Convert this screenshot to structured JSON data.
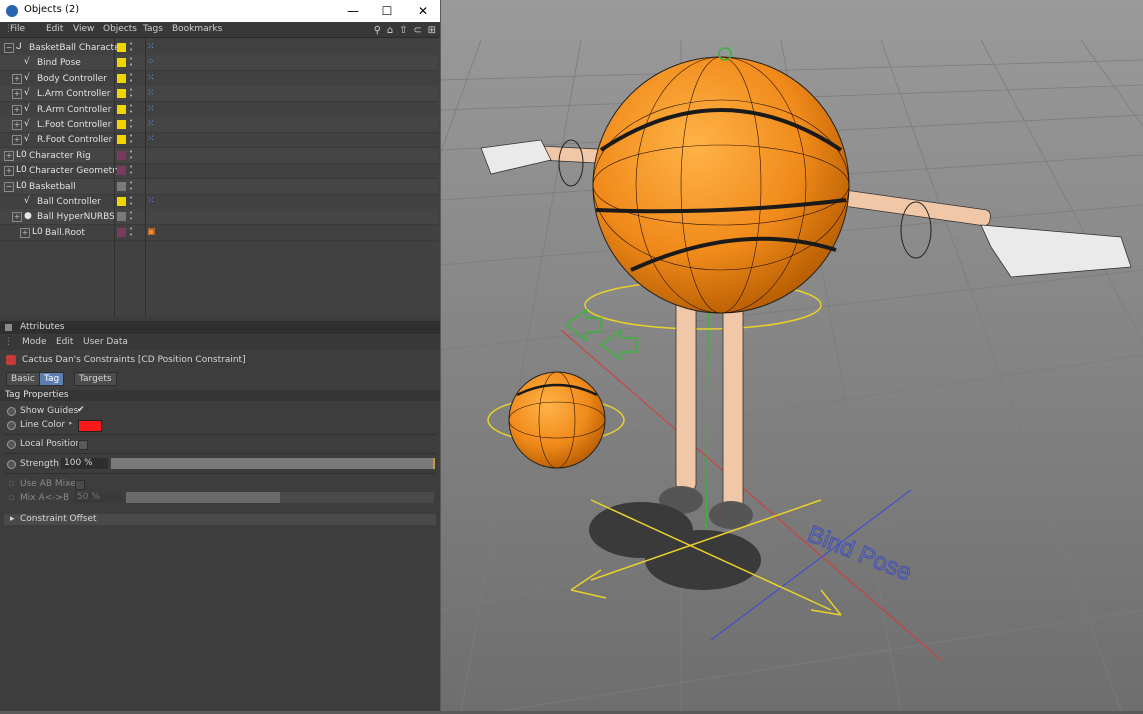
{
  "window": {
    "title": "Objects (2)",
    "minimize": "—",
    "maximize": "☐",
    "close": "✕"
  },
  "objects_menu": [
    "File",
    "Edit",
    "View",
    "Objects",
    "Tags",
    "Bookmarks"
  ],
  "tree": [
    {
      "label": "BasketBall Character",
      "indent": 0,
      "icon": "null-icon",
      "expand": "−",
      "color": "#f2d400",
      "tag": "xpresso-tag"
    },
    {
      "label": "Bind Pose",
      "indent": 1,
      "icon": "spline-icon",
      "expand": "",
      "color": "#f2d400",
      "tag": "pose-tag"
    },
    {
      "label": "Body Controller",
      "indent": 1,
      "icon": "spline-icon",
      "expand": "+",
      "color": "#f2d400",
      "tag": "xpresso-tag"
    },
    {
      "label": "L.Arm Controller",
      "indent": 1,
      "icon": "spline-icon",
      "expand": "+",
      "color": "#f2d400",
      "tag": "xpresso-tag"
    },
    {
      "label": "R.Arm Controller",
      "indent": 1,
      "icon": "spline-icon",
      "expand": "+",
      "color": "#f2d400",
      "tag": "xpresso-tag"
    },
    {
      "label": "L.Foot Controller",
      "indent": 1,
      "icon": "spline-icon",
      "expand": "+",
      "color": "#f2d400",
      "tag": "xpresso-tag"
    },
    {
      "label": "R.Foot Controller",
      "indent": 1,
      "icon": "spline-icon",
      "expand": "+",
      "color": "#f2d400",
      "tag": "xpresso-tag"
    },
    {
      "label": "Character Rig",
      "indent": 0,
      "icon": "null-object-icon",
      "expand": "+",
      "color": "#7a3a5e",
      "tag": ""
    },
    {
      "label": "Character Geometry",
      "indent": 0,
      "icon": "null-object-icon",
      "expand": "+",
      "color": "#7a3a5e",
      "tag": ""
    },
    {
      "label": "Basketball",
      "indent": 0,
      "icon": "null-object-icon",
      "expand": "−",
      "color": "#7a7a7a",
      "tag": ""
    },
    {
      "label": "Ball Controller",
      "indent": 1,
      "icon": "spline-icon",
      "expand": "",
      "color": "#f2d400",
      "tag": "xpresso-tag"
    },
    {
      "label": "Ball HyperNURBS",
      "indent": 1,
      "icon": "hypernurbs-icon",
      "expand": "+",
      "color": "#7a7a7a",
      "tag": ""
    },
    {
      "label": "Ball.Root",
      "indent": 2,
      "icon": "null-object-icon",
      "expand": "+",
      "color": "#7a3a5e",
      "tag": "constraint-tag"
    }
  ],
  "attributes": {
    "header": "Attributes",
    "menu": [
      "Mode",
      "Edit",
      "User Data"
    ],
    "tag_title": "Cactus Dan's Constraints [CD Position Constraint]",
    "tabs": [
      "Basic",
      "Tag",
      "Targets"
    ],
    "active_tab": "Tag",
    "section": "Tag Properties",
    "show_guides": {
      "label": "Show Guides",
      "checked": "✔"
    },
    "line_color": {
      "label": "Line Color",
      "color": "#ff1a1a"
    },
    "local_position": {
      "label": "Local Position"
    },
    "strength": {
      "label": "Strength",
      "value": "100 %",
      "fraction": 1.0
    },
    "use_ab_mixer": {
      "label": "Use AB Mixer"
    },
    "mix": {
      "label": "Mix A<->B",
      "value": "50 %",
      "fraction": 0.5
    },
    "constraint_offset": "Constraint Offset"
  },
  "viewport": {
    "annotation": "Bind Pose"
  }
}
